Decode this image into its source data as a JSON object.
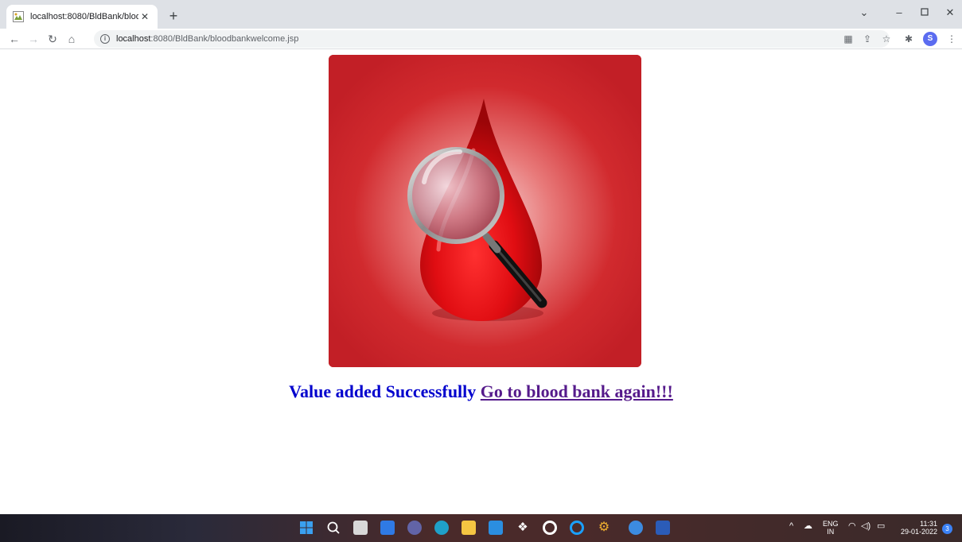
{
  "browser": {
    "tab_title": "localhost:8080/BldBank/bloodba",
    "tab_close": "✕",
    "new_tab": "+",
    "url_host": "localhost",
    "url_path": ":8080/BldBank/bloodbankwelcome.jsp",
    "profile_initial": "S"
  },
  "page": {
    "message": "Value added Successfully",
    "link_text": "Go to blood bank again!!!"
  },
  "taskbar": {
    "lang_top": "ENG",
    "lang_bottom": "IN",
    "time": "11:31",
    "date": "29-01-2022",
    "notifications": "3"
  },
  "colors": {
    "message": "#0000cd",
    "link": "#551a8b",
    "hero_bg": "#c8202a"
  }
}
